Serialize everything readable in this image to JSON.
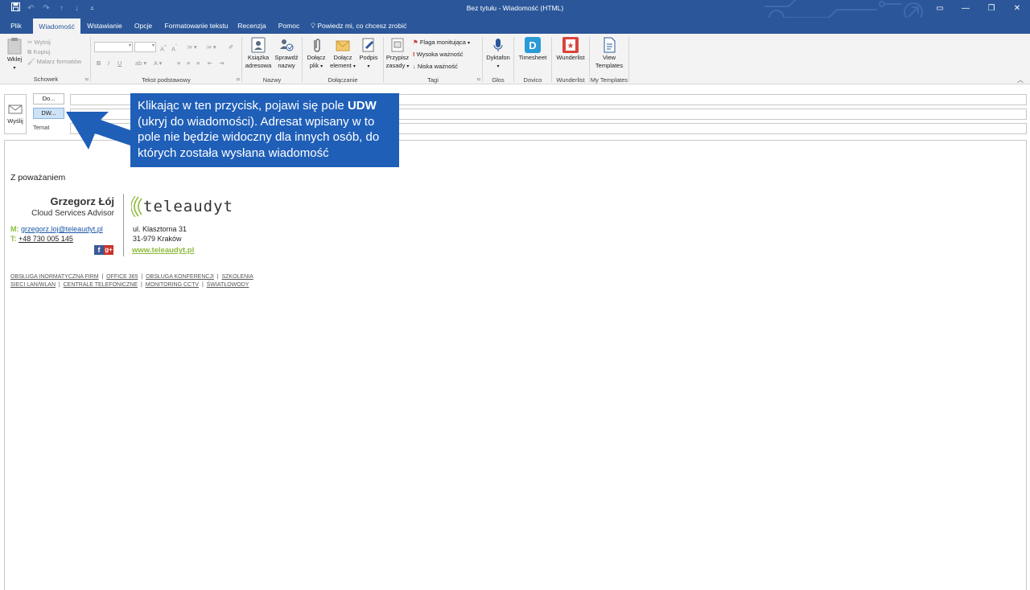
{
  "window": {
    "title": "Bez tytułu  -  Wiadomość (HTML)",
    "controls": [
      "▭",
      "—",
      "❐",
      "✕"
    ]
  },
  "qat": [
    "save-icon",
    "undo-icon",
    "redo-icon",
    "up-icon",
    "down-icon",
    "customize-icon"
  ],
  "tabs": [
    "Plik",
    "Wiadomość",
    "Wstawianie",
    "Opcje",
    "Formatowanie tekstu",
    "Recenzja",
    "Pomoc"
  ],
  "active_tab": "Wiadomość",
  "tell_me": "Powiedz mi, co chcesz zrobić",
  "ribbon": {
    "clipboard": {
      "label": "Schowek",
      "paste": "Wklej",
      "cut": "Wytnij",
      "copy": "Kopiuj",
      "format_painter": "Malarz formatów"
    },
    "basic_text": {
      "label": "Tekst podstawowy"
    },
    "names": {
      "label": "Nazwy",
      "address_book_1": "Książka",
      "address_book_2": "adresowa",
      "check_names_1": "Sprawdź",
      "check_names_2": "nazwy"
    },
    "include": {
      "label": "Dołączanie",
      "attach_file_1": "Dołącz",
      "attach_file_2": "plik",
      "attach_item_1": "Dołącz",
      "attach_item_2": "element",
      "signature": "Podpis"
    },
    "tags": {
      "label": "Tagi",
      "assign_policy_1": "Przypisz",
      "assign_policy_2": "zasady",
      "follow_up": "Flaga monitująca",
      "high": "Wysoka ważność",
      "low": "Niska ważność"
    },
    "voice": {
      "label": "Głos",
      "dictate": "Dyktafon"
    },
    "dovico": {
      "label": "Dovico",
      "timesheet": "Timesheet"
    },
    "wunderlist": {
      "label": "Wunderlist",
      "btn": "Wunderlist"
    },
    "templates": {
      "label": "My Templates",
      "view_1": "View",
      "view_2": "Templates"
    }
  },
  "compose": {
    "send": "Wyślij",
    "to": "Do...",
    "cc": "DW...",
    "subject": "Temat"
  },
  "callout": {
    "part1": "Klikając w ten przycisk, pojawi się pole ",
    "bold": "UDW",
    "part2": " (ukryj do wiadomości). Adresat wpisany w to pole nie będzie widoczny dla innych osób, do których została wysłana wiadomość"
  },
  "signature": {
    "greeting": "Z poważaniem",
    "name": "Grzegorz Łój",
    "role": "Cloud Services Advisor",
    "m_label": "M:",
    "email": "grzegorz.loj@teleaudyt.pl",
    "t_label": "T:",
    "phone": "+48 730 005 145",
    "logo": "teleaudyt",
    "street": "ul. Klasztorna 31",
    "city": "31-979 Kraków",
    "www": "www.teleaudyt.pl",
    "links_row1": [
      "OBSŁUGA INORMATYCZNA FIRM",
      "OFFICE 365",
      "OBSŁUGA KONFERENCJI",
      "SZKOLENIA"
    ],
    "links_row2": [
      "SIECI LAN/WLAN",
      "CENTRALE TELEFONICZNE",
      "MONITORING CCTV",
      "ŚWIATŁOWODY"
    ]
  },
  "colors": {
    "brand": "#2b579a",
    "callout": "#1f5fb8",
    "green": "#8dbb3a"
  }
}
